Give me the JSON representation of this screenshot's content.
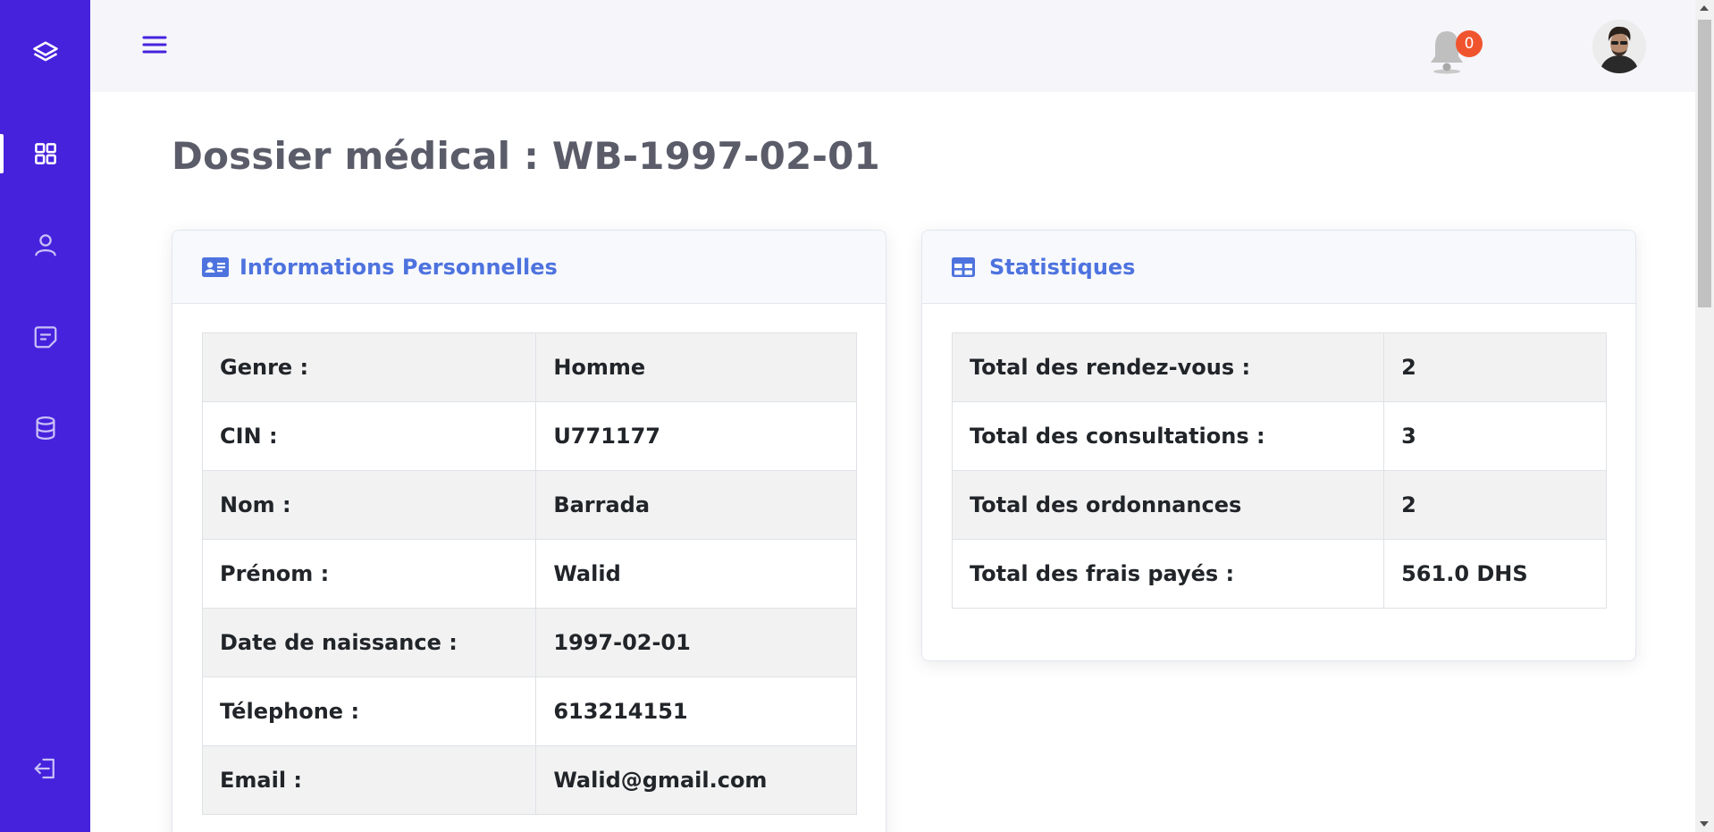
{
  "topbar": {
    "notification_count": "0"
  },
  "page": {
    "title": "Dossier médical : WB-1997-02-01"
  },
  "personal_card": {
    "header": "Informations Personnelles",
    "rows": [
      {
        "label": "Genre :",
        "value": "Homme"
      },
      {
        "label": "CIN :",
        "value": "U771177"
      },
      {
        "label": "Nom :",
        "value": "Barrada"
      },
      {
        "label": "Prénom :",
        "value": "Walid"
      },
      {
        "label": "Date de naissance :",
        "value": "1997-02-01"
      },
      {
        "label": "Télephone :",
        "value": "613214151"
      },
      {
        "label": "Email :",
        "value": "Walid@gmail.com"
      }
    ]
  },
  "stats_card": {
    "header": "Statistiques",
    "rows": [
      {
        "label": "Total des rendez-vous :",
        "value": "2"
      },
      {
        "label": "Total des consultations :",
        "value": "3"
      },
      {
        "label": "Total des ordonnances",
        "value": "2"
      },
      {
        "label": "Total des frais payés :",
        "value": "561.0 DHS"
      }
    ]
  },
  "icons": {
    "sidebar": [
      "layers-icon",
      "dashboard-grid-icon",
      "user-icon",
      "message-icon",
      "database-icon",
      "logout-icon"
    ],
    "topbar": [
      "hamburger-menu-icon",
      "bell-icon"
    ],
    "cards": [
      "id-card-icon",
      "table-icon"
    ]
  },
  "colors": {
    "sidebar": "#4622dd",
    "accent": "#4e73df",
    "badge": "#f0542f",
    "title": "#5a5c69"
  }
}
